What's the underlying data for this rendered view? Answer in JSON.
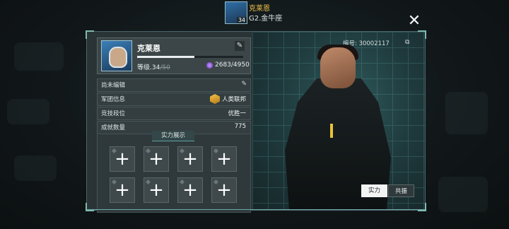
{
  "top": {
    "player_name": "克莱恩",
    "rank": "G2.金牛座",
    "avatar_level": "34"
  },
  "close_icon": "close-icon",
  "profile": {
    "name": "克莱恩",
    "level_label": "等级.34",
    "level_strike": "/50",
    "exp": "2683/4950",
    "exp_progress": 0.542
  },
  "rows": {
    "signature": {
      "label": "尚未编辑"
    },
    "guild": {
      "label": "军团信息",
      "value": "人类联邦"
    },
    "arena": {
      "label": "竞技段位",
      "value": "优胜一"
    },
    "achievements": {
      "label": "成就数量",
      "value": "775"
    }
  },
  "showcase": {
    "title": "实力展示"
  },
  "character": {
    "id_text": "编号: 30002117"
  },
  "tabs": {
    "power": "实力",
    "resonance": "共振"
  },
  "colors": {
    "accent_gold": "#f0c24a",
    "panel_bg": "#2a3436",
    "teal_line": "#6fa8a8"
  }
}
